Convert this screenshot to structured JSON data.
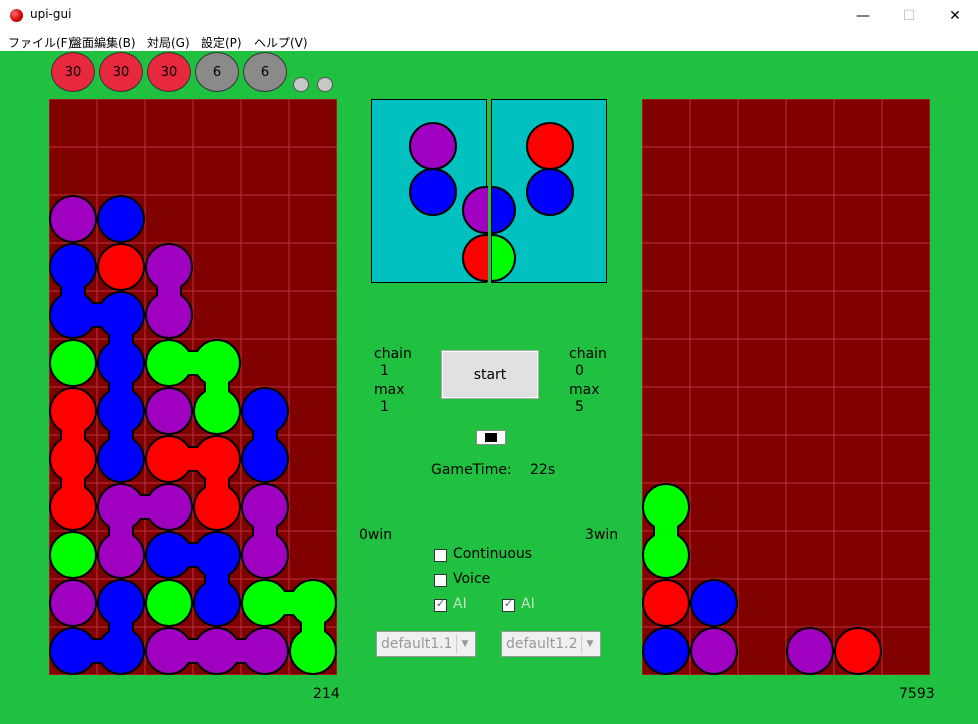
{
  "window": {
    "title": "upi-gui",
    "controls": {
      "minimize": "—",
      "maximize": "☐",
      "close": "✕"
    }
  },
  "menu": [
    {
      "label": "ファイル(F)"
    },
    {
      "label": "盤面編集(B)"
    },
    {
      "label": "対局(G)"
    },
    {
      "label": "設定(P)"
    },
    {
      "label": "ヘルプ(V)"
    }
  ],
  "ojama": {
    "counters": [
      "30",
      "30",
      "30",
      "6",
      "6"
    ],
    "small_count": 2
  },
  "colors": {
    "red": "#ff0000",
    "blue": "#0000ff",
    "purple": "#a000c0",
    "green": "#00ff00",
    "board_bg": "#800000",
    "grid": "#c03040"
  },
  "player1": {
    "board": [
      [
        ".",
        ".",
        ".",
        ".",
        ".",
        "."
      ],
      [
        ".",
        ".",
        ".",
        ".",
        ".",
        "."
      ],
      [
        "P",
        "B",
        ".",
        ".",
        ".",
        "."
      ],
      [
        "B",
        "R",
        "P",
        ".",
        ".",
        "."
      ],
      [
        "B",
        "B",
        "P",
        ".",
        ".",
        "."
      ],
      [
        "G",
        "B",
        "G",
        "G",
        ".",
        "."
      ],
      [
        "R",
        "B",
        "P",
        "G",
        "B",
        "."
      ],
      [
        "R",
        "B",
        "R",
        "R",
        "B",
        "."
      ],
      [
        "R",
        "P",
        "P",
        "R",
        "P",
        "."
      ],
      [
        "G",
        "P",
        "B",
        "B",
        "P",
        "."
      ],
      [
        "P",
        "B",
        "G",
        "B",
        "G",
        "G"
      ],
      [
        "B",
        "B",
        "P",
        "P",
        "P",
        "G"
      ]
    ],
    "chain_label": "chain",
    "chain": "1",
    "max_label": "max",
    "max": "1",
    "wins": "0win",
    "score": "214",
    "next": [
      [
        "P",
        "B"
      ],
      [
        "P",
        "R"
      ]
    ]
  },
  "player2": {
    "board": [
      [
        ".",
        ".",
        ".",
        ".",
        ".",
        "."
      ],
      [
        ".",
        ".",
        ".",
        ".",
        ".",
        "."
      ],
      [
        ".",
        ".",
        ".",
        ".",
        ".",
        "."
      ],
      [
        ".",
        ".",
        ".",
        ".",
        ".",
        "."
      ],
      [
        ".",
        ".",
        ".",
        ".",
        ".",
        "."
      ],
      [
        ".",
        ".",
        ".",
        ".",
        ".",
        "."
      ],
      [
        ".",
        ".",
        ".",
        ".",
        ".",
        "."
      ],
      [
        ".",
        ".",
        ".",
        ".",
        ".",
        "."
      ],
      [
        "G",
        ".",
        ".",
        ".",
        ".",
        "."
      ],
      [
        "G",
        ".",
        ".",
        ".",
        ".",
        "."
      ],
      [
        "R",
        "B",
        ".",
        ".",
        ".",
        "."
      ],
      [
        "B",
        "P",
        ".",
        "P",
        "R",
        "."
      ]
    ],
    "chain_label": "chain",
    "chain": "0",
    "max_label": "max",
    "max": "5",
    "wins": "3win",
    "score": "7593",
    "next": [
      [
        "R",
        "B"
      ],
      [
        "B",
        "G"
      ]
    ]
  },
  "controls": {
    "start_label": "start",
    "gametime_label": "GameTime:",
    "gametime_value": "22s",
    "continuous_label": "Continuous",
    "continuous_checked": false,
    "voice_label": "Voice",
    "voice_checked": false,
    "ai1_label": "AI",
    "ai2_label": "AI",
    "ai_checked": true,
    "ai1_select": "default1.1",
    "ai2_select": "default1.2"
  }
}
